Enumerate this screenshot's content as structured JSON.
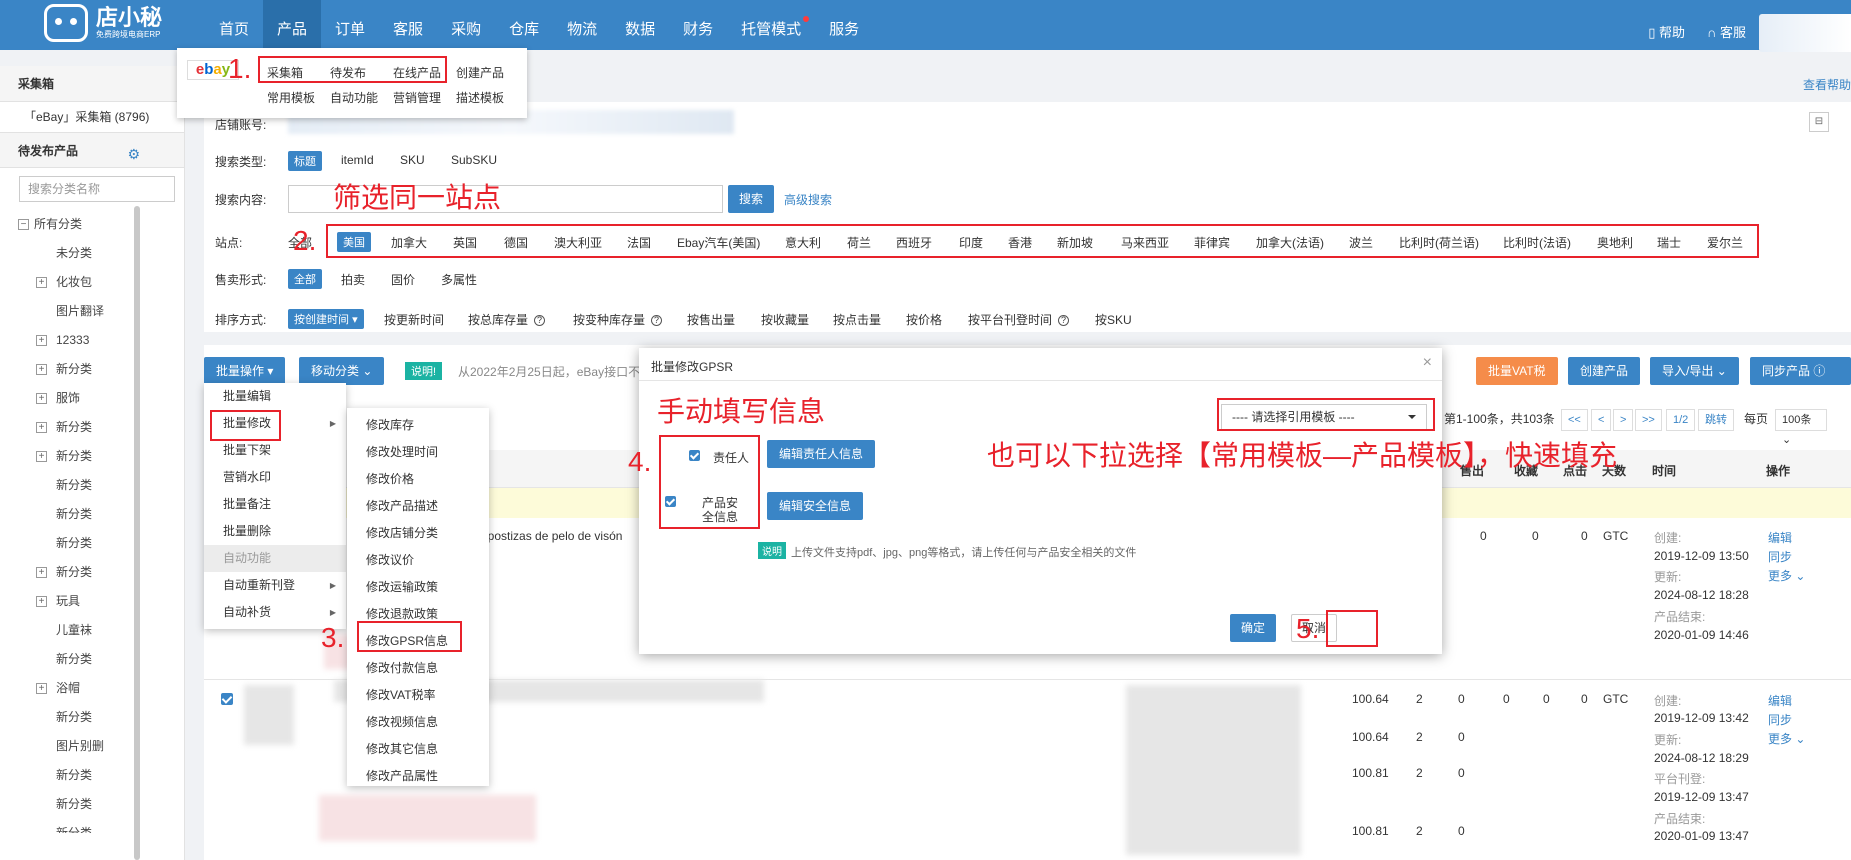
{
  "brand": {
    "name": "店小秘",
    "tagline": "免费跨境电商ERP"
  },
  "nav": {
    "items": [
      "首页",
      "产品",
      "订单",
      "客服",
      "采购",
      "仓库",
      "物流",
      "数据",
      "财务",
      "托管模式",
      "服务"
    ],
    "help": "帮助",
    "service": "客服"
  },
  "product_menu": {
    "row1": [
      "采集箱",
      "待发布",
      "在线产品",
      "创建产品"
    ],
    "row2": [
      "常用模板",
      "自动功能",
      "营销管理",
      "描述模板"
    ]
  },
  "sidebar": {
    "section1": "采集箱",
    "ebay_box": "「eBay」采集箱 (8796)",
    "section2": "待发布产品",
    "search_placeholder": "搜索分类名称",
    "tree": [
      "所有分类",
      "未分类",
      "化妆包",
      "图片翻译",
      "12333",
      "新分类",
      "服饰",
      "新分类",
      "新分类",
      "新分类",
      "新分类",
      "新分类",
      "新分类",
      "玩具",
      "儿童袜",
      "新分类",
      "浴帽",
      "新分类",
      "图片别删",
      "新分类",
      "新分类",
      "新分类"
    ]
  },
  "help_link": "查看帮助",
  "filters": {
    "shop_label": "店铺账号:",
    "search_type_label": "搜索类型:",
    "search_types": [
      "标题",
      "itemId",
      "SKU",
      "SubSKU"
    ],
    "search_content_label": "搜索内容:",
    "search_btn": "搜索",
    "advanced": "高级搜索",
    "site_label": "站点:",
    "sites": [
      "全部",
      "美国",
      "加拿大",
      "英国",
      "德国",
      "澳大利亚",
      "法国",
      "Ebay汽车(美国)",
      "意大利",
      "荷兰",
      "西班牙",
      "印度",
      "香港",
      "新加坡",
      "马来西亚",
      "菲律宾",
      "加拿大(法语)",
      "波兰",
      "比利时(荷兰语)",
      "比利时(法语)",
      "奥地利",
      "瑞士",
      "爱尔兰"
    ],
    "sale_label": "售卖形式:",
    "sale_types": [
      "全部",
      "拍卖",
      "固价",
      "多属性"
    ],
    "sort_label": "排序方式:",
    "sorts": [
      "按创建时间",
      "按更新时间",
      "按总库存量",
      "按变种库存量",
      "按售出量",
      "按收藏量",
      "按点击量",
      "按价格",
      "按平台刊登时间",
      "按SKU"
    ]
  },
  "actions": {
    "batch_op": "批量操作",
    "move_cat": "移动分类",
    "notice_tag": "说明!",
    "notice_text": "从2022年2月25日起，eBay接口不再",
    "vat": "批量VAT税",
    "create": "创建产品",
    "import_export": "导入/导出",
    "sync": "同步产品"
  },
  "pager": {
    "range": "第1-100条，共103条",
    "first": "<<",
    "prev": "<",
    "next": ">",
    "last": ">>",
    "page": "1/2",
    "jump": "跳转",
    "per_page_label": "每页",
    "per_page": "100条"
  },
  "table": {
    "headers": [
      "售出",
      "收藏",
      "点击",
      "天数",
      "时间",
      "操作"
    ],
    "rows": [
      {
        "title_frag": "ñas postizas de pelo de visón",
        "sold": "0",
        "fav": "0",
        "click": "0",
        "days": "GTC",
        "times": [
          "创建:",
          "2019-12-09 13:50",
          "更新:",
          "2024-08-12 18:28",
          "产品结束:",
          "2020-01-09 14:46"
        ],
        "ops": [
          "编辑",
          "同步",
          "更多"
        ]
      },
      {
        "prices": [
          "100.64",
          "100.64",
          "100.81",
          "100.81"
        ],
        "qtys": [
          "2",
          "2",
          "2",
          "2"
        ],
        "zeros": [
          "0",
          "0",
          "0",
          "0"
        ],
        "sold": "0",
        "fav": "0",
        "click": "0",
        "days": "GTC",
        "times": [
          "创建:",
          "2019-12-09 13:42",
          "更新:",
          "2024-08-12 18:29",
          "平台刊登:",
          "2019-12-09 13:47",
          "产品结束:",
          "2020-01-09 13:47"
        ],
        "ops": [
          "编辑",
          "同步",
          "更多"
        ]
      }
    ]
  },
  "batch_menu": [
    "批量编辑",
    "批量修改",
    "批量下架",
    "营销水印",
    "批量备注",
    "批量删除",
    "自动功能",
    "自动重新刊登",
    "自动补货"
  ],
  "modify_menu": [
    "修改库存",
    "修改处理时间",
    "修改价格",
    "修改产品描述",
    "修改店铺分类",
    "修改议价",
    "修改运输政策",
    "修改退款政策",
    "修改GPSR信息",
    "修改付款信息",
    "修改VAT税率",
    "修改视频信息",
    "修改其它信息",
    "修改产品属性"
  ],
  "modal": {
    "title": "批量修改GPSR",
    "template_placeholder": "---- 请选择引用模板 ----",
    "resp_label": "责任人",
    "resp_btn": "编辑责任人信息",
    "safety_label": "产品安全信息",
    "safety_btn": "编辑安全信息",
    "info_tag": "说明",
    "info_text": "上传文件支持pdf、jpg、png等格式，请上传任何与产品安全相关的文件",
    "ok": "确定",
    "cancel": "取消"
  },
  "annotations": {
    "n1": "1.",
    "n2": "2.",
    "n3": "3.",
    "n4": "4.",
    "n5": "5.",
    "filter_site": "筛选同一站点",
    "manual_fill": "手动填写信息",
    "dropdown_hint": "也可以下拉选择【常用模板—产品模板】，快速填充"
  },
  "colors": {
    "primary": "#3a85c6",
    "annotation": "#e8222b",
    "orange": "#f58c4a",
    "teal": "#1bb3a3"
  }
}
